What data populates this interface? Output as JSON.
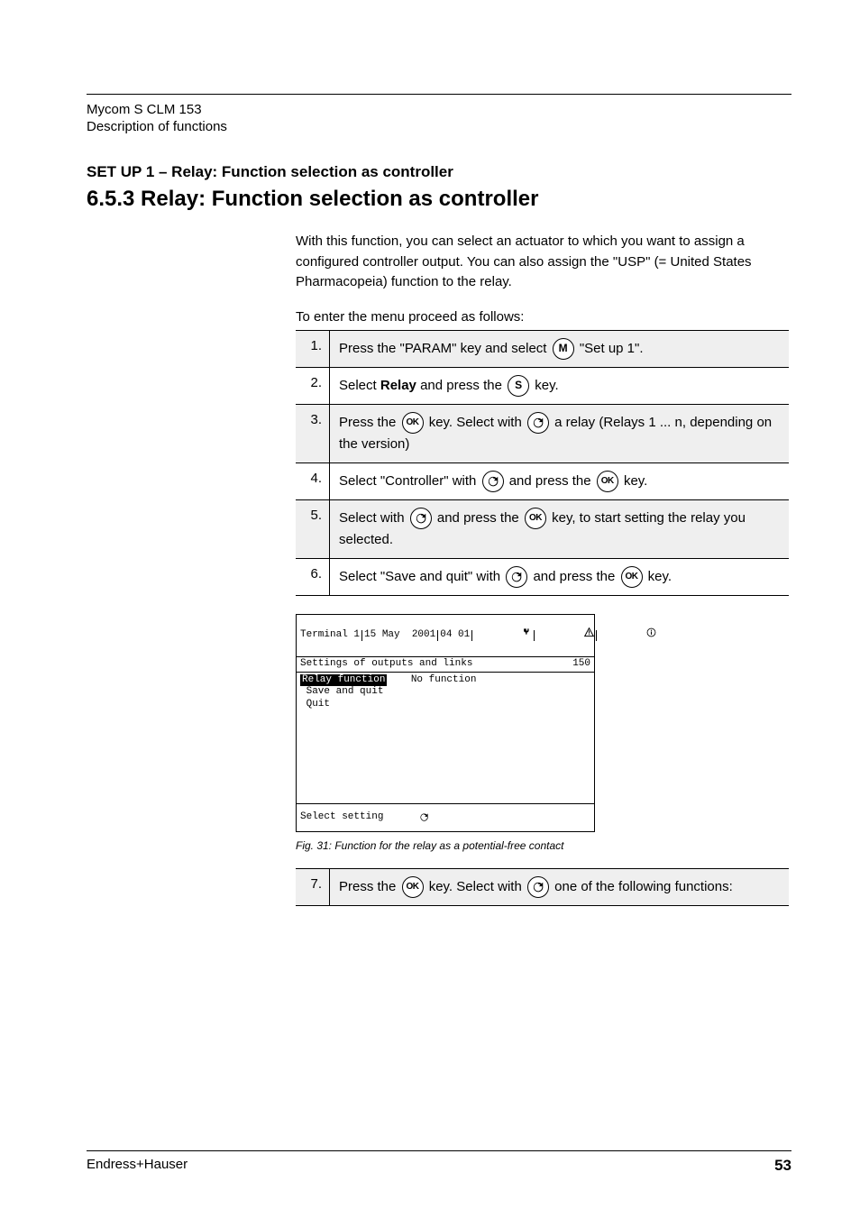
{
  "header": {
    "doc_title": "Mycom S CLM 153",
    "doc_sub": "Description of functions"
  },
  "section": {
    "path": "SET UP 1 – Relay: Function selection as controller",
    "title": "6.5.3 Relay: Function selection as controller",
    "intro": "With this function, you can select an actuator to which you want to assign a configured controller output. You can also assign the \"USP\" (= United States Pharmacopeia) function to the relay.",
    "to_enter": "To enter the menu proceed as follows:"
  },
  "steps": [
    {
      "n": "1.",
      "pre": "Press the \"PARAM\" key and select ",
      "post": ""
    },
    {
      "n": "2.",
      "pre": "Select ",
      "mid": " and press the ",
      "post": " key."
    },
    {
      "n": "3.",
      "pre": "Press the ",
      "mid": " key. Select with ",
      "post": "a relay (Relays 1 ... n, depending on the version)"
    },
    {
      "n": "4.",
      "pre": "Select \"Controller\" with ",
      "mid": " and press the ",
      "post": " key."
    },
    {
      "n": "5.",
      "pre": "Select with ",
      "mid": " and press the ",
      "after": " key, to start setting the relay you selected.",
      "post": ""
    },
    {
      "n": "6.",
      "pre": "Select \"Save and quit\" with ",
      "mid": " and press the ",
      "post": " key."
    }
  ],
  "screenshot": {
    "title": "Terminal 1",
    "date": "15 May  2001",
    "time": "04 01",
    "subtitle": "Settings of outputs and links",
    "code": "150",
    "row1_label": "Relay function",
    "row1_value": "No function",
    "row2": "Save and quit",
    "row3": "Quit",
    "footer": "Select setting",
    "caption": "Fig. 31:  Function for the relay as a potential-free contact"
  },
  "icons": {
    "M": "M",
    "S": "S",
    "OK": "OK"
  },
  "labels": {
    "set_up_1": "\"Set up 1\".",
    "relay": "Relay"
  },
  "step7": {
    "n": "7.",
    "pre": "Press the ",
    "mid": " key. Select with ",
    "after": " one of the following functions:"
  },
  "footer": {
    "company": "Endress+Hauser",
    "page": "53"
  }
}
